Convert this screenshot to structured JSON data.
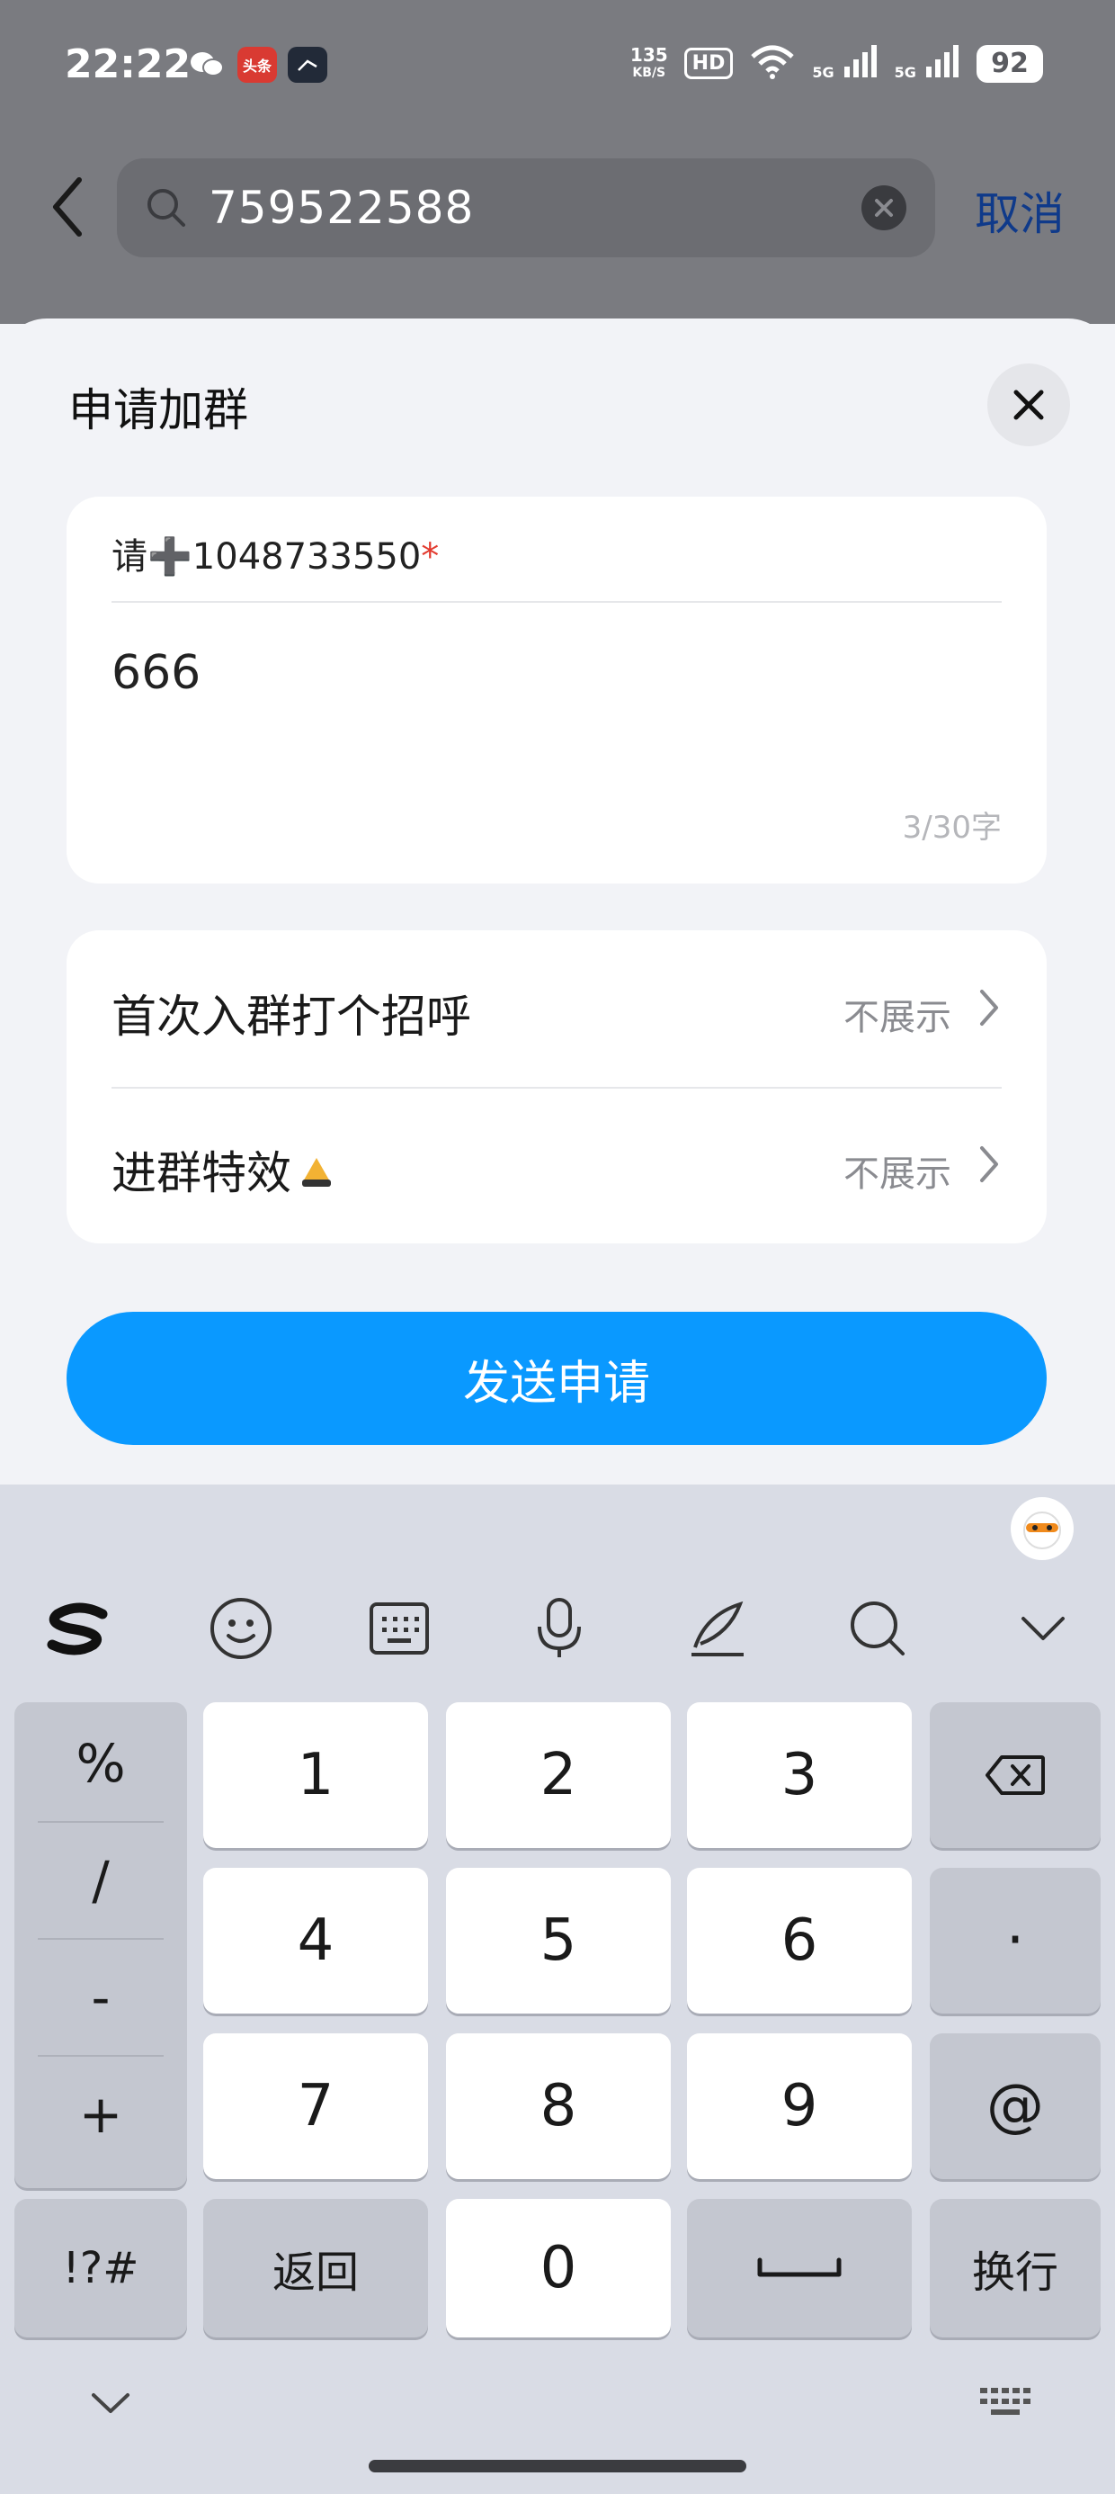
{
  "status_bar": {
    "time": "22:22",
    "toutiao_label": "头条",
    "net_speed_value": "135",
    "net_speed_unit": "KB/S",
    "hd_label": "HD",
    "signal1_label": "5G",
    "signal2_label": "5G",
    "battery": "92"
  },
  "search": {
    "query": "759522588",
    "cancel_label": "取消"
  },
  "sheet": {
    "title": "申请加群",
    "message_label": "请➕1048733550",
    "required_mark": "*",
    "message_value": "666",
    "char_counter": "3/30字",
    "options": [
      {
        "label": "首次入群打个招呼",
        "value": "不展示"
      },
      {
        "label": "进群特效",
        "value": "不展示"
      }
    ],
    "send_label": "发送申请"
  },
  "keyboard": {
    "symbols": [
      "%",
      "/",
      "-",
      "+"
    ],
    "digits": [
      "1",
      "2",
      "3",
      "4",
      "5",
      "6",
      "7",
      "8",
      "9",
      "0"
    ],
    "dot_key": "·",
    "at_key": "@",
    "special_key": "!?#",
    "back_key": "返回",
    "enter_key": "换行",
    "toolbar_icons": [
      "sogou-logo-icon",
      "emoji-icon",
      "keyboard-layout-icon",
      "microphone-icon",
      "handwriting-icon",
      "search-icon",
      "collapse-chevron-icon"
    ]
  },
  "colors": {
    "accent": "#0a99ff",
    "dim_overlay": "#7a7b80",
    "required": "#e33b2f"
  }
}
